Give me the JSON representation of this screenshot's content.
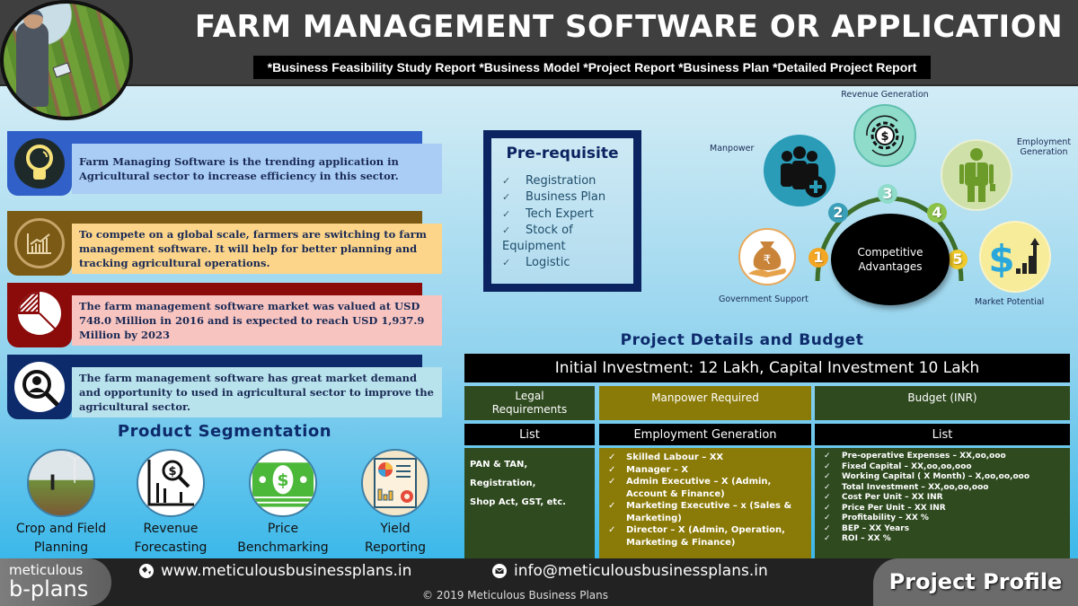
{
  "header": {
    "title": "FARM MANAGEMENT SOFTWARE OR APPLICATION",
    "subtitle": "*Business Feasibility Study Report  *Business Model  *Project Report  *Business Plan  *Detailed Project Report",
    "photo_alt": "farmer-with-tablet-in-field"
  },
  "info_cards": [
    {
      "icon": "lightbulb-icon",
      "text": "Farm Managing Software is the trending application in Agricultural sector to increase efficiency in this sector.",
      "colors": {
        "tab": "#3060c8",
        "text_bg": "#a9cdf5"
      }
    },
    {
      "icon": "growth-chart-icon",
      "text": "To compete on a global scale, farmers are switching to farm management software. It will help for better planning and tracking agricultural operations.",
      "colors": {
        "tab": "#7a5a14",
        "text_bg": "#fcd58a"
      }
    },
    {
      "icon": "pie-chart-icon",
      "text": "The farm management software market was valued at USD 748.0 Million in 2016 and is expected to reach USD 1,937.9 Million by 2023",
      "colors": {
        "tab": "#8b0a0a",
        "text_bg": "#f8c4c0"
      }
    },
    {
      "icon": "person-search-icon",
      "text": "The farm management software has great market demand and opportunity to used in agricultural sector to improve the agricultural sector.",
      "colors": {
        "tab": "#0d2a6b",
        "text_bg": "#b8e2ec"
      }
    }
  ],
  "product_segmentation": {
    "title": "Product  Segmentation",
    "items": [
      {
        "icon": "field-photo-icon",
        "label_line1": "Crop and Field",
        "label_line2": "Planning"
      },
      {
        "icon": "revenue-search-icon",
        "label_line1": "Revenue",
        "label_line2": "Forecasting"
      },
      {
        "icon": "money-bill-icon",
        "label_line1": "Price",
        "label_line2": "Benchmarking"
      },
      {
        "icon": "report-document-icon",
        "label_line1": "Yield",
        "label_line2": "Reporting"
      }
    ]
  },
  "prerequisite": {
    "title": "Pre-requisite",
    "check_glyph": "✓",
    "items": [
      "Registration",
      "Business Plan",
      "Tech Expert",
      "Stock of Equipment",
      "Logistic"
    ]
  },
  "competitive_advantages": {
    "center_line1": "Competitive",
    "center_line2": "Advantages",
    "items": [
      {
        "num": "1",
        "label": "Government Support",
        "color": "#f3a623",
        "icon": "rupee-bag-hand-icon"
      },
      {
        "num": "2",
        "label": "Manpower",
        "color": "#3a9fb8",
        "icon": "team-add-icon"
      },
      {
        "num": "3",
        "label": "Revenue Generation",
        "color": "#8fdccb",
        "icon": "dollar-gear-icon"
      },
      {
        "num": "4",
        "label_line1": "Employment",
        "label_line2": "Generation",
        "color": "#8cc14a",
        "icon": "employee-icon"
      },
      {
        "num": "5",
        "label": "Market Potential",
        "color": "#f0c92a",
        "icon": "dollar-growth-icon"
      }
    ]
  },
  "project_details": {
    "title": "Project  Details  and  Budget",
    "investment_banner": "Initial Investment: 12 Lakh,  Capital Investment 10 Lakh",
    "columns": [
      {
        "header_line1": "Legal",
        "header_line2": "Requirements",
        "subheader": "List",
        "content": [
          "PAN & TAN, Registration,",
          "Shop Act, GST, etc."
        ]
      },
      {
        "header": "Manpower Required",
        "subheader": "Employment Generation",
        "items": [
          "Skilled Labour – XX",
          "Manager – X",
          "Admin Executive – X (Admin, Account & Finance)",
          "Marketing Executive – x (Sales & Marketing)",
          "Director – X (Admin, Operation, Marketing & Finance)"
        ]
      },
      {
        "header": "Budget (INR)",
        "subheader": "List",
        "items": [
          "Pre-operative Expenses – XX,oo,ooo",
          "Fixed Capital – XX,oo,oo,ooo",
          "Working Capital ( X Month) –  X,oo,oo,ooo",
          "Total Investment – XX,oo,oo,ooo",
          "Cost Per Unit – XX INR",
          "Price Per Unit – XX INR",
          "Profitability – XX %",
          "BEP – XX Years",
          " ROI – XX %"
        ]
      }
    ]
  },
  "footer": {
    "logo_line1": "meticulous",
    "logo_line2": "b-plans",
    "website": "www.meticulousbusinessplans.in",
    "email": "info@meticulousbusinessplans.in",
    "copyright": "© 2019 Meticulous Business Plans",
    "profile_label": "Project Profile"
  }
}
